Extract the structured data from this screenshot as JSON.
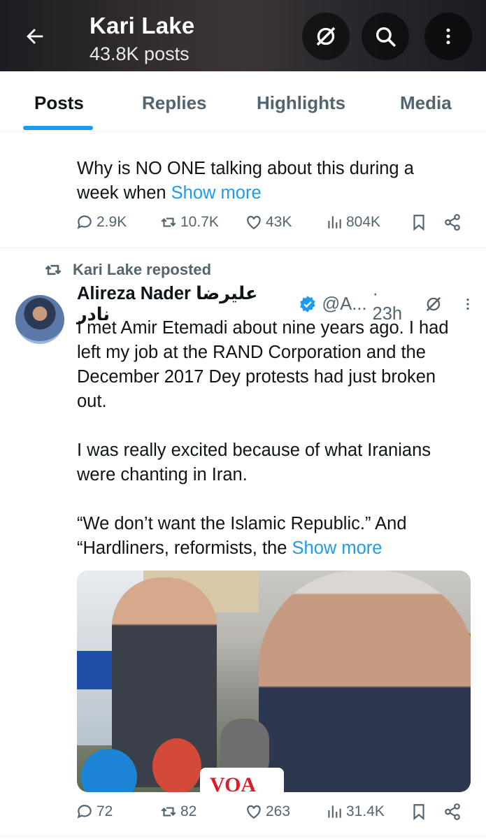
{
  "header": {
    "title": "Kari Lake",
    "subtitle": "43.8K posts"
  },
  "tabs": [
    {
      "label": "Posts",
      "active": true
    },
    {
      "label": "Replies",
      "active": false
    },
    {
      "label": "Highlights",
      "active": false
    },
    {
      "label": "Media",
      "active": false
    }
  ],
  "post1": {
    "text_line1": "Why is NO ONE talking about this during a",
    "text_line2_prefix": "week when ",
    "show_more": "Show more",
    "stats": {
      "replies": "2.9K",
      "reposts": "10.7K",
      "likes": "43K",
      "views": "804K"
    }
  },
  "post2": {
    "repost_label": "Kari Lake reposted",
    "author_name": "Alireza Nader علیرضا نادر",
    "handle": "@A...",
    "time": "· 23h",
    "verified": true,
    "lines": [
      "I met Amir Etemadi about nine years ago. I had",
      "left my job at the RAND Corporation and the",
      "December 2017 Dey protests had just broken",
      "out.",
      "I was really excited because of what Iranians",
      "were chanting in Iran.",
      "“We don’t want the Islamic Republic.” And"
    ],
    "last_line_prefix": "“Hardliners, reformists, the ",
    "show_more": "Show more",
    "media_label": "VOA",
    "stats": {
      "replies": "72",
      "reposts": "82",
      "likes": "263",
      "views": "31.4K"
    }
  },
  "colors": {
    "accent": "#1d9bf0",
    "muted": "#536471",
    "text": "#0f1419",
    "verified": "#1d9bf0"
  }
}
